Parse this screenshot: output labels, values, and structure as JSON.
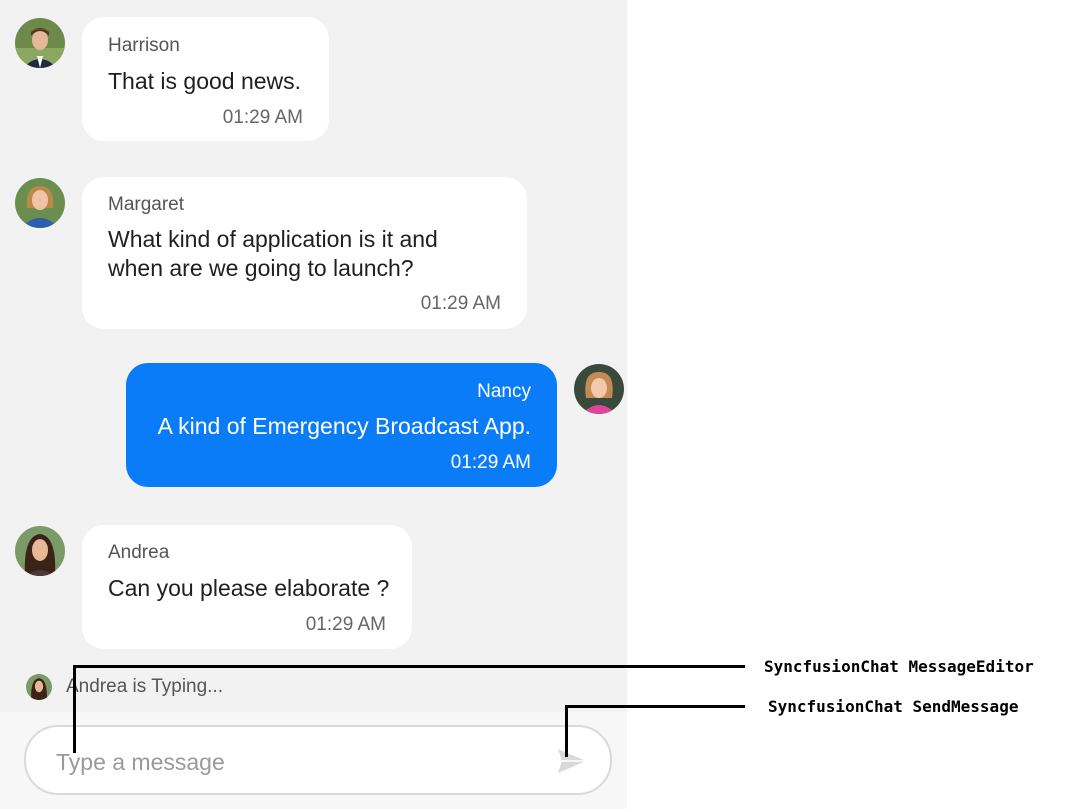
{
  "messages": [
    {
      "sender": "Harrison",
      "text_lines": [
        "That is good news."
      ],
      "time": "01:29 AM",
      "direction": "incoming"
    },
    {
      "sender": "Margaret",
      "text_lines": [
        "What kind of application is it and",
        "when are we going to launch?"
      ],
      "time": "01:29 AM",
      "direction": "incoming"
    },
    {
      "sender": "Nancy",
      "text_lines": [
        "A kind of Emergency Broadcast App."
      ],
      "time": "01:29 AM",
      "direction": "outgoing"
    },
    {
      "sender": "Andrea",
      "text_lines": [
        "Can you please elaborate ?"
      ],
      "time": "01:29 AM",
      "direction": "incoming"
    }
  ],
  "typing_indicator": "Andrea is Typing...",
  "editor": {
    "placeholder": "Type a message"
  },
  "annotations": {
    "message_editor": "SyncfusionChat MessageEditor",
    "send_message": "SyncfusionChat SendMessage"
  },
  "colors": {
    "outgoing_bubble": "#0a7cf7",
    "incoming_bubble": "#ffffff",
    "chat_background": "#f2f2f2"
  },
  "icons": {
    "send": "send-arrow-icon",
    "avatar": "user-avatar-icon"
  }
}
